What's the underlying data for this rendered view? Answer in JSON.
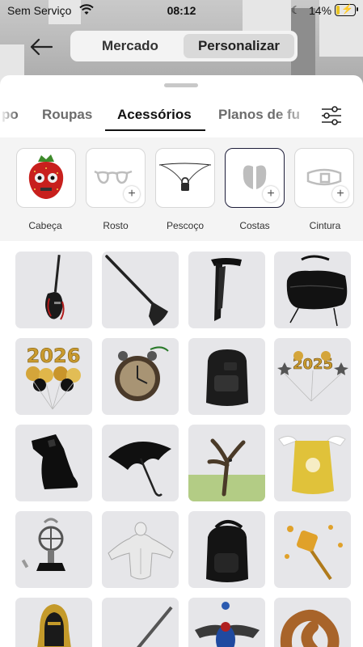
{
  "status": {
    "carrier": "Sem Serviço",
    "time": "08:12",
    "battery": "14%"
  },
  "header": {
    "segments": [
      "Mercado",
      "Personalizar"
    ],
    "selected": "Personalizar"
  },
  "tabs": {
    "items": [
      "po",
      "Roupas",
      "Acessórios",
      "Planos de fu"
    ],
    "active": "Acessórios"
  },
  "slots": [
    {
      "label": "Cabeça",
      "icon": "strawberry-head-icon"
    },
    {
      "label": "Rosto",
      "icon": "glasses-icon"
    },
    {
      "label": "Pescoço",
      "icon": "necklace-lock-icon"
    },
    {
      "label": "Costas",
      "icon": "wings-icon"
    },
    {
      "label": "Cintura",
      "icon": "belt-icon"
    }
  ],
  "items": [
    {
      "icon": "guitar-icon",
      "text": ""
    },
    {
      "icon": "axe-icon",
      "text": ""
    },
    {
      "icon": "scarf-icon",
      "text": ""
    },
    {
      "icon": "bag-icon",
      "text": ""
    },
    {
      "icon": "balloons-2026-icon",
      "text": "2026"
    },
    {
      "icon": "clock-icon",
      "text": ""
    },
    {
      "icon": "backpack-icon",
      "text": ""
    },
    {
      "icon": "balloons-2025-icon",
      "text": "2025"
    },
    {
      "icon": "cape-icon",
      "text": ""
    },
    {
      "icon": "umbrella-icon",
      "text": ""
    },
    {
      "icon": "tree-icon",
      "text": ""
    },
    {
      "icon": "yellow-cape-icon",
      "text": ""
    },
    {
      "icon": "trophy-icon",
      "text": ""
    },
    {
      "icon": "muscle-torso-icon",
      "text": ""
    },
    {
      "icon": "black-backpack-icon",
      "text": ""
    },
    {
      "icon": "coin-staff-icon",
      "text": ""
    },
    {
      "icon": "pharaoh-icon",
      "text": ""
    },
    {
      "icon": "guitar2-icon",
      "text": ""
    },
    {
      "icon": "scarab-icon",
      "text": ""
    },
    {
      "icon": "pretzel-icon",
      "text": ""
    }
  ]
}
